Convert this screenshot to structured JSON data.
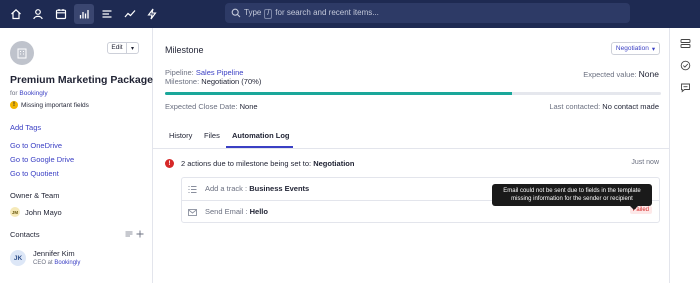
{
  "nav": {
    "items": [
      {
        "name": "home-icon"
      },
      {
        "name": "person-icon"
      },
      {
        "name": "calendar-icon"
      },
      {
        "name": "bar-chart-icon",
        "active": true
      },
      {
        "name": "list-icon"
      },
      {
        "name": "trend-icon"
      },
      {
        "name": "lightning-icon"
      }
    ],
    "search": {
      "prefix": "Type",
      "key": "/",
      "suffix": "for search and recent items..."
    }
  },
  "sidebar": {
    "edit_label": "Edit",
    "deal_title": "Premium Marketing Package",
    "for_prefix": "for",
    "company": "Bookingly",
    "warning": "Missing important fields",
    "add_tags": "Add Tags",
    "links": [
      "Go to OneDrive",
      "Go to Google Drive",
      "Go to Quotient"
    ],
    "owner_section": "Owner & Team",
    "owner": {
      "initials": "JM",
      "name": "John Mayo"
    },
    "contacts_section": "Contacts",
    "contact": {
      "initials": "JK",
      "name": "Jennifer Kim",
      "role": "CEO at",
      "company": "Bookingly"
    }
  },
  "main": {
    "title": "Milestone",
    "stage_button": "Negotiation",
    "pipeline_label": "Pipeline:",
    "pipeline": "Sales Pipeline",
    "milestone_label": "Milestone:",
    "milestone": "Negotiation (70%)",
    "milestone_progress": 0.7,
    "expected_value_label": "Expected value:",
    "expected_value": "None",
    "close_date_label": "Expected Close Date:",
    "close_date": "None",
    "last_contacted_label": "Last contacted:",
    "last_contacted": "No contact made",
    "tabs": [
      "History",
      "Files",
      "Automation Log"
    ],
    "active_tab": 2,
    "activity": {
      "text": "2 actions due to milestone being set to:",
      "stage": "Negotiation",
      "time": "Just now",
      "actions": [
        {
          "label": "Add a track :",
          "value": "Business Events"
        },
        {
          "label": "Send Email :",
          "value": "Hello",
          "status": "Failed"
        }
      ],
      "tooltip_line1": "Email could not be sent due to fields in the template",
      "tooltip_line2": "missing information for the sender or recipient"
    }
  },
  "colors": {
    "topbar": "#1e2a52",
    "link": "#3a3fc4",
    "progress": "#1aa79a",
    "error": "#d62828",
    "warning": "#f1b400"
  }
}
